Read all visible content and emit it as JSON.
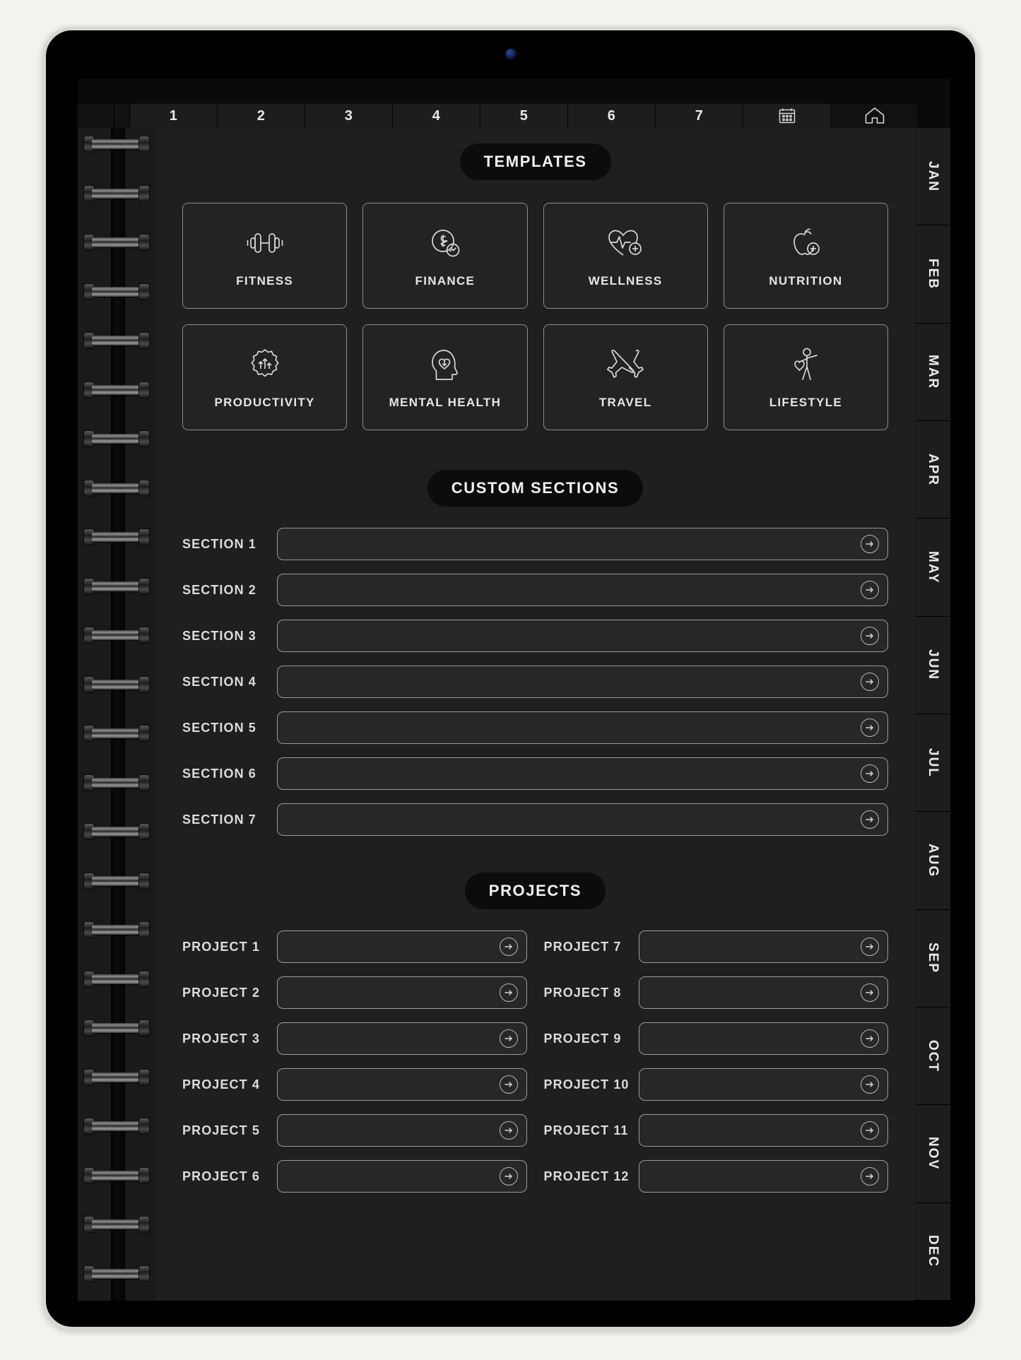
{
  "device": {
    "camera": "front-camera"
  },
  "top_tabs": {
    "numbers": [
      "1",
      "2",
      "3",
      "4",
      "5",
      "6",
      "7"
    ],
    "calendar_icon": "calendar-icon",
    "home_icon": "home-icon"
  },
  "templates": {
    "heading": "TEMPLATES",
    "cards": [
      {
        "label": "FITNESS",
        "icon": "dumbbell-icon"
      },
      {
        "label": "FINANCE",
        "icon": "dollar-coin-icon"
      },
      {
        "label": "WELLNESS",
        "icon": "heart-pulse-plus-icon"
      },
      {
        "label": "NUTRITION",
        "icon": "apple-plus-icon"
      },
      {
        "label": "PRODUCTIVITY",
        "icon": "growth-arrows-badge-icon"
      },
      {
        "label": "MENTAL HEALTH",
        "icon": "head-heart-icon"
      },
      {
        "label": "TRAVEL",
        "icon": "crossed-planes-icon"
      },
      {
        "label": "LIFESTYLE",
        "icon": "person-heart-icon"
      }
    ]
  },
  "custom_sections": {
    "heading": "CUSTOM SECTIONS",
    "rows": [
      {
        "label": "SECTION 1",
        "value": "",
        "arrow": "arrow-right-icon"
      },
      {
        "label": "SECTION 2",
        "value": "",
        "arrow": "arrow-right-icon"
      },
      {
        "label": "SECTION 3",
        "value": "",
        "arrow": "arrow-right-icon"
      },
      {
        "label": "SECTION 4",
        "value": "",
        "arrow": "arrow-right-icon"
      },
      {
        "label": "SECTION 5",
        "value": "",
        "arrow": "arrow-right-icon"
      },
      {
        "label": "SECTION 6",
        "value": "",
        "arrow": "arrow-right-icon"
      },
      {
        "label": "SECTION 7",
        "value": "",
        "arrow": "arrow-right-icon"
      }
    ]
  },
  "projects": {
    "heading": "PROJECTS",
    "rows": [
      {
        "label": "PROJECT 1",
        "value": "",
        "arrow": "arrow-right-icon"
      },
      {
        "label": "PROJECT 7",
        "value": "",
        "arrow": "arrow-right-icon"
      },
      {
        "label": "PROJECT 2",
        "value": "",
        "arrow": "arrow-right-icon"
      },
      {
        "label": "PROJECT 8",
        "value": "",
        "arrow": "arrow-right-icon"
      },
      {
        "label": "PROJECT 3",
        "value": "",
        "arrow": "arrow-right-icon"
      },
      {
        "label": "PROJECT 9",
        "value": "",
        "arrow": "arrow-right-icon"
      },
      {
        "label": "PROJECT 4",
        "value": "",
        "arrow": "arrow-right-icon"
      },
      {
        "label": "PROJECT 10",
        "value": "",
        "arrow": "arrow-right-icon"
      },
      {
        "label": "PROJECT 5",
        "value": "",
        "arrow": "arrow-right-icon"
      },
      {
        "label": "PROJECT 11",
        "value": "",
        "arrow": "arrow-right-icon"
      },
      {
        "label": "PROJECT 6",
        "value": "",
        "arrow": "arrow-right-icon"
      },
      {
        "label": "PROJECT 12",
        "value": "",
        "arrow": "arrow-right-icon"
      }
    ]
  },
  "month_tabs": [
    "JAN",
    "FEB",
    "MAR",
    "APR",
    "MAY",
    "JUN",
    "JUL",
    "AUG",
    "SEP",
    "OCT",
    "NOV",
    "DEC"
  ],
  "colors": {
    "outer_background": "#f4f2ed",
    "device_bezel": "#000000",
    "device_edge": "#d9d6d0",
    "page_background": "#1f1f1f",
    "tab_background": "#1d1d1d",
    "pill_background": "#0c0c0c",
    "text": "#e8e8e8",
    "stroke": "#9a9a9a"
  }
}
